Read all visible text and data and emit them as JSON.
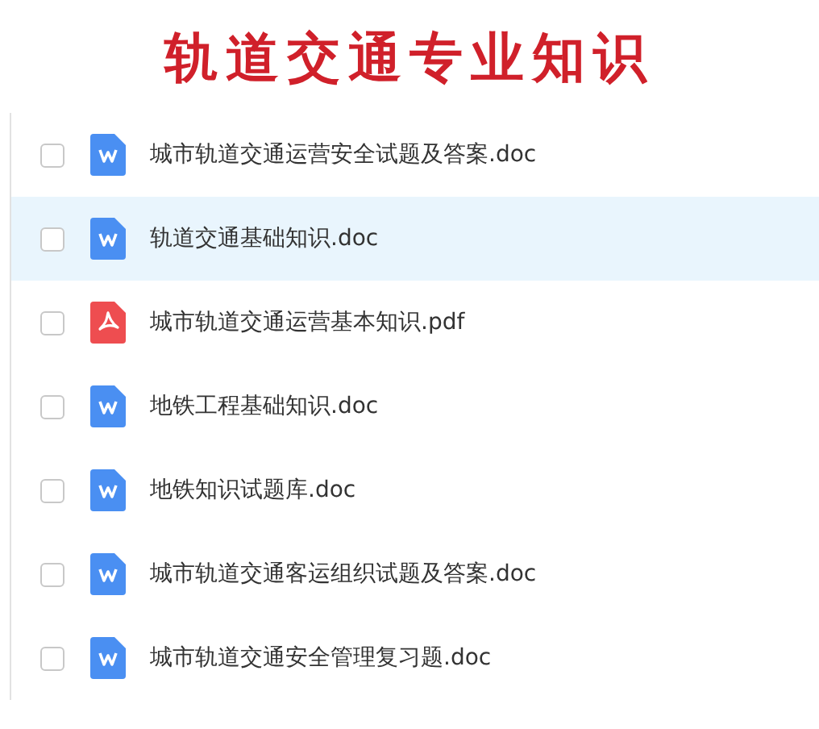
{
  "title": "轨道交通专业知识",
  "files": [
    {
      "name": "城市轨道交通运营安全试题及答案.doc",
      "kind": "doc",
      "selected": false,
      "checked": false
    },
    {
      "name": "轨道交通基础知识.doc",
      "kind": "doc",
      "selected": true,
      "checked": false
    },
    {
      "name": "城市轨道交通运营基本知识.pdf",
      "kind": "pdf",
      "selected": false,
      "checked": false
    },
    {
      "name": "地铁工程基础知识.doc",
      "kind": "doc",
      "selected": false,
      "checked": false
    },
    {
      "name": "地铁知识试题库.doc",
      "kind": "doc",
      "selected": false,
      "checked": false
    },
    {
      "name": "城市轨道交通客运组织试题及答案.doc",
      "kind": "doc",
      "selected": false,
      "checked": false
    },
    {
      "name": "城市轨道交通安全管理复习题.doc",
      "kind": "doc",
      "selected": false,
      "checked": false
    }
  ]
}
